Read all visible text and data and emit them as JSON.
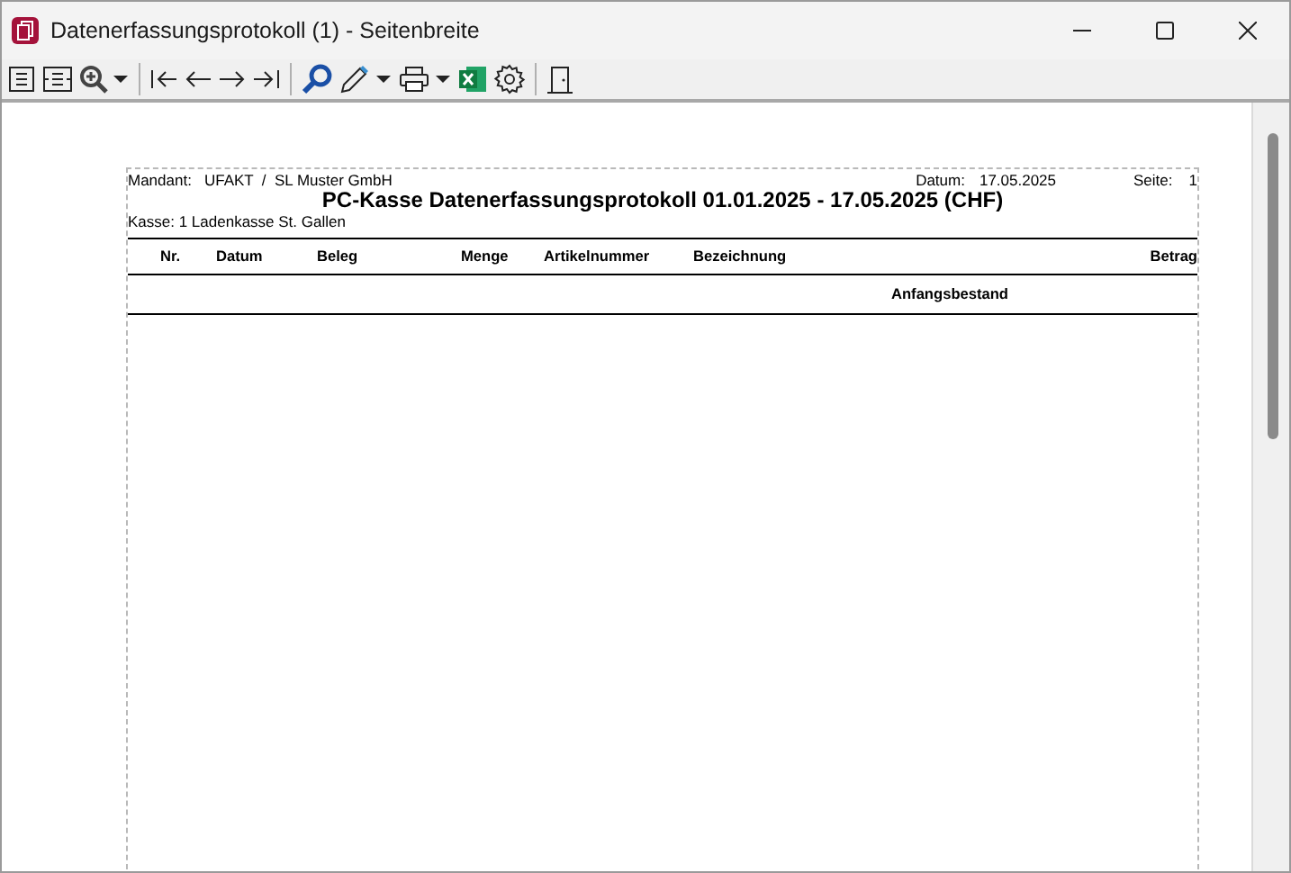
{
  "window": {
    "title": "Datenerfassungsprotokoll (1) - Seitenbreite"
  },
  "report": {
    "mandant_label": "Mandant:",
    "mandant_value": "UFAKT  /  SL Muster GmbH",
    "datum_label": "Datum:",
    "datum_value": "17.05.2025",
    "seite_label": "Seite:",
    "seite_value": "1",
    "title": "PC-Kasse Datenerfassungsprotokoll 01.01.2025 - 17.05.2025 (CHF)",
    "kasse": "Kasse: 1 Ladenkasse St. Gallen",
    "columns": [
      "Nr.",
      "Datum",
      "Beleg",
      "Menge",
      "Artikelnummer",
      "Bezeichnung",
      "Betrag"
    ],
    "rows": [
      {
        "bezeichnung": "Anfangsbestand"
      }
    ]
  }
}
